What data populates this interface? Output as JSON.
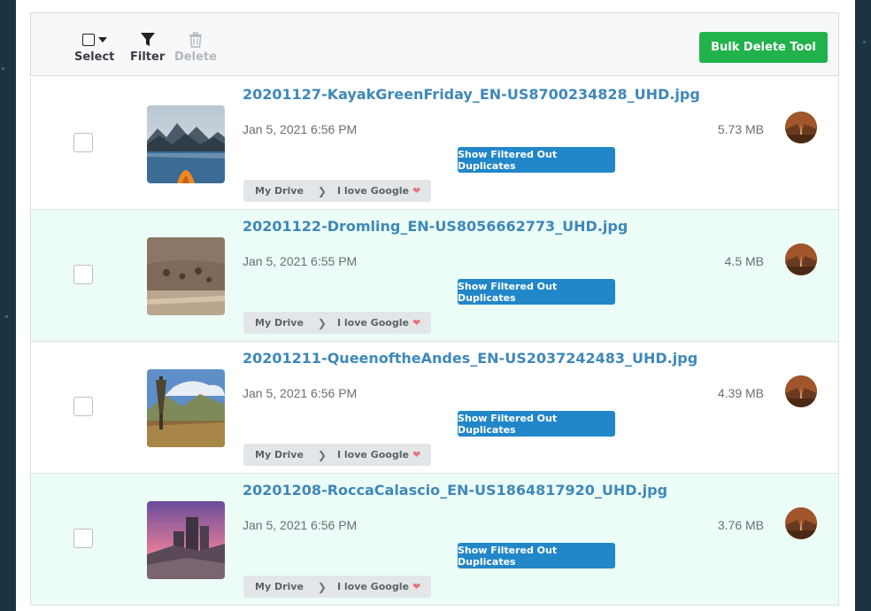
{
  "toolbar": {
    "select_label": "Select",
    "filter_label": "Filter",
    "delete_label": "Delete",
    "bulk_delete_label": "Bulk Delete Tool"
  },
  "colors": {
    "accent_green": "#22b24c",
    "accent_blue": "#2287c8",
    "link_blue": "#3f88b8",
    "alt_row_bg": "#ecfdf8"
  },
  "files": [
    {
      "name": "20201127-KayakGreenFriday_EN-US8700234828_UHD.jpg",
      "date": "Jan 5, 2021 6:56 PM",
      "size": "5.73 MB",
      "button": "Show Filtered Out Duplicates",
      "path": [
        "My Drive",
        "I love Google"
      ],
      "thumb_icon": "kayak-lake-thumbnail"
    },
    {
      "name": "20201122-Dromling_EN-US8056662773_UHD.jpg",
      "date": "Jan 5, 2021 6:55 PM",
      "size": "4.5 MB",
      "button": "Show Filtered Out Duplicates",
      "path": [
        "My Drive",
        "I love Google"
      ],
      "thumb_icon": "deer-field-thumbnail"
    },
    {
      "name": "20201211-QueenoftheAndes_EN-US2037242483_UHD.jpg",
      "date": "Jan 5, 2021 6:56 PM",
      "size": "4.39 MB",
      "button": "Show Filtered Out Duplicates",
      "path": [
        "My Drive",
        "I love Google"
      ],
      "thumb_icon": "andes-plant-thumbnail"
    },
    {
      "name": "20201208-RoccaCalascio_EN-US1864817920_UHD.jpg",
      "date": "Jan 5, 2021 6:56 PM",
      "size": "3.76 MB",
      "button": "Show Filtered Out Duplicates",
      "path": [
        "My Drive",
        "I love Google"
      ],
      "thumb_icon": "rocca-calascio-thumbnail"
    }
  ]
}
